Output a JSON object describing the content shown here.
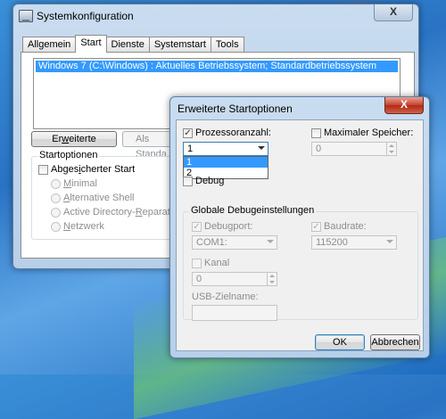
{
  "main_window": {
    "title": "Systemkonfiguration",
    "close_glyph": "X",
    "tabs": [
      {
        "label": "Allgemein"
      },
      {
        "label": "Start"
      },
      {
        "label": "Dienste"
      },
      {
        "label": "Systemstart"
      },
      {
        "label": "Tools"
      }
    ],
    "active_tab": "Start",
    "boot_entries": [
      "Windows 7 (C:\\Windows) : Aktuelles Betriebssystem; Standardbetriebssystem"
    ],
    "advanced_button": {
      "prefix": "Er",
      "accel": "w",
      "suffix": "eiterte Optionen..."
    },
    "default_button": {
      "label": "Als Standa"
    },
    "boot_options": {
      "title": "Startoptionen",
      "safe_boot": {
        "pre": "Abges",
        "accel": "i",
        "post": "cherter Start"
      },
      "radios": [
        {
          "accel": "M",
          "rest": "inimal"
        },
        {
          "accel": "A",
          "rest": "lternative Shell"
        },
        {
          "pre": "Active Directory-",
          "accel": "R",
          "rest": "eparatur"
        },
        {
          "accel": "N",
          "rest": "etzwerk"
        }
      ]
    }
  },
  "dialog": {
    "title": "Erweiterte Startoptionen",
    "close_glyph": "X",
    "processor_count": {
      "label": "Prozessoranzahl:",
      "checked": true,
      "value": "1",
      "options": [
        "1",
        "2"
      ],
      "selected": "1"
    },
    "max_memory": {
      "label": "Maximaler Speicher:",
      "checked": false,
      "value": "0"
    },
    "debug": {
      "label": "Debug",
      "checked": false
    },
    "debug_settings": {
      "title": "Globale Debugeinstellungen",
      "debug_port": {
        "label": "Debugport:",
        "checked": true,
        "value": "COM1:"
      },
      "baud_rate": {
        "label": "Baudrate:",
        "checked": true,
        "value": "115200"
      },
      "channel": {
        "label": "Kanal",
        "checked": false,
        "value": "0"
      },
      "usb_target": {
        "label": "USB-Zielname:",
        "value": ""
      }
    },
    "ok_label": "OK",
    "cancel_label": "Abbrechen"
  },
  "icons": {
    "window_icon": "system-config-icon",
    "close": "close-icon",
    "dropdown": "chevron-down-icon"
  }
}
